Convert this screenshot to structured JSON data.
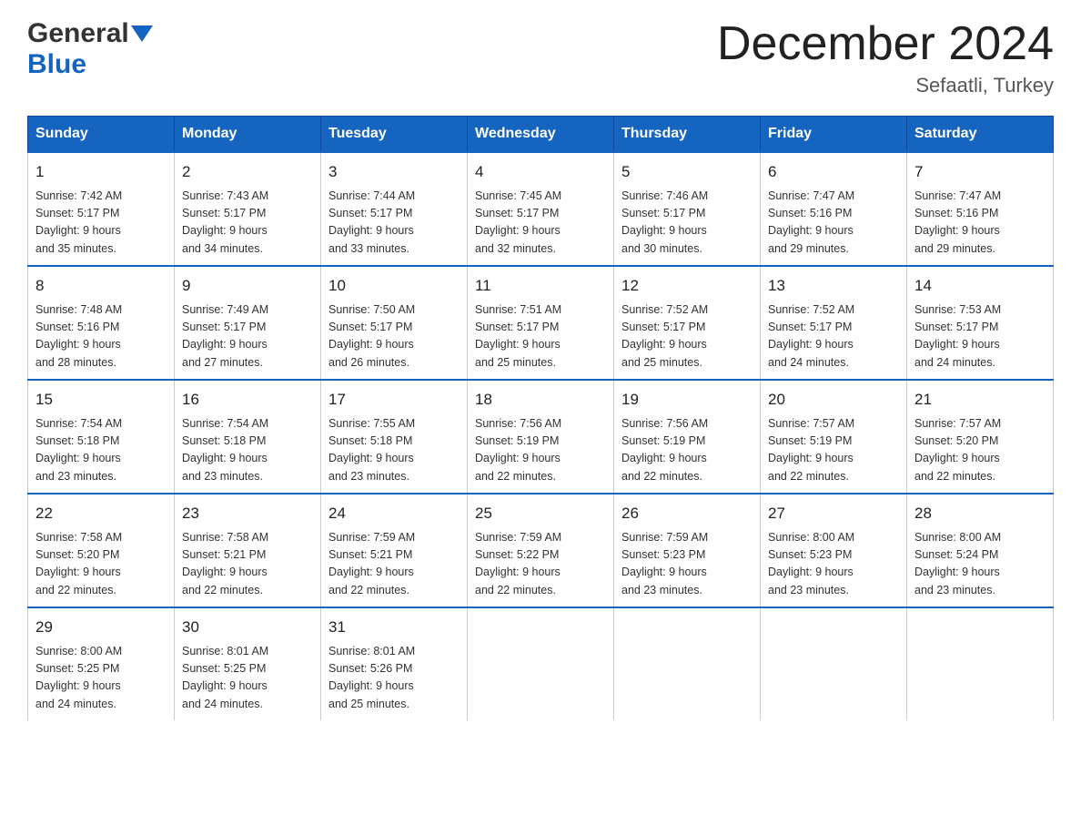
{
  "header": {
    "logo_general": "General",
    "logo_arrow": "▼",
    "logo_blue": "Blue",
    "month_title": "December 2024",
    "location": "Sefaatli, Turkey"
  },
  "days_of_week": [
    "Sunday",
    "Monday",
    "Tuesday",
    "Wednesday",
    "Thursday",
    "Friday",
    "Saturday"
  ],
  "weeks": [
    [
      {
        "day": "1",
        "sunrise": "7:42 AM",
        "sunset": "5:17 PM",
        "daylight": "9 hours and 35 minutes."
      },
      {
        "day": "2",
        "sunrise": "7:43 AM",
        "sunset": "5:17 PM",
        "daylight": "9 hours and 34 minutes."
      },
      {
        "day": "3",
        "sunrise": "7:44 AM",
        "sunset": "5:17 PM",
        "daylight": "9 hours and 33 minutes."
      },
      {
        "day": "4",
        "sunrise": "7:45 AM",
        "sunset": "5:17 PM",
        "daylight": "9 hours and 32 minutes."
      },
      {
        "day": "5",
        "sunrise": "7:46 AM",
        "sunset": "5:17 PM",
        "daylight": "9 hours and 30 minutes."
      },
      {
        "day": "6",
        "sunrise": "7:47 AM",
        "sunset": "5:16 PM",
        "daylight": "9 hours and 29 minutes."
      },
      {
        "day": "7",
        "sunrise": "7:47 AM",
        "sunset": "5:16 PM",
        "daylight": "9 hours and 29 minutes."
      }
    ],
    [
      {
        "day": "8",
        "sunrise": "7:48 AM",
        "sunset": "5:16 PM",
        "daylight": "9 hours and 28 minutes."
      },
      {
        "day": "9",
        "sunrise": "7:49 AM",
        "sunset": "5:17 PM",
        "daylight": "9 hours and 27 minutes."
      },
      {
        "day": "10",
        "sunrise": "7:50 AM",
        "sunset": "5:17 PM",
        "daylight": "9 hours and 26 minutes."
      },
      {
        "day": "11",
        "sunrise": "7:51 AM",
        "sunset": "5:17 PM",
        "daylight": "9 hours and 25 minutes."
      },
      {
        "day": "12",
        "sunrise": "7:52 AM",
        "sunset": "5:17 PM",
        "daylight": "9 hours and 25 minutes."
      },
      {
        "day": "13",
        "sunrise": "7:52 AM",
        "sunset": "5:17 PM",
        "daylight": "9 hours and 24 minutes."
      },
      {
        "day": "14",
        "sunrise": "7:53 AM",
        "sunset": "5:17 PM",
        "daylight": "9 hours and 24 minutes."
      }
    ],
    [
      {
        "day": "15",
        "sunrise": "7:54 AM",
        "sunset": "5:18 PM",
        "daylight": "9 hours and 23 minutes."
      },
      {
        "day": "16",
        "sunrise": "7:54 AM",
        "sunset": "5:18 PM",
        "daylight": "9 hours and 23 minutes."
      },
      {
        "day": "17",
        "sunrise": "7:55 AM",
        "sunset": "5:18 PM",
        "daylight": "9 hours and 23 minutes."
      },
      {
        "day": "18",
        "sunrise": "7:56 AM",
        "sunset": "5:19 PM",
        "daylight": "9 hours and 22 minutes."
      },
      {
        "day": "19",
        "sunrise": "7:56 AM",
        "sunset": "5:19 PM",
        "daylight": "9 hours and 22 minutes."
      },
      {
        "day": "20",
        "sunrise": "7:57 AM",
        "sunset": "5:19 PM",
        "daylight": "9 hours and 22 minutes."
      },
      {
        "day": "21",
        "sunrise": "7:57 AM",
        "sunset": "5:20 PM",
        "daylight": "9 hours and 22 minutes."
      }
    ],
    [
      {
        "day": "22",
        "sunrise": "7:58 AM",
        "sunset": "5:20 PM",
        "daylight": "9 hours and 22 minutes."
      },
      {
        "day": "23",
        "sunrise": "7:58 AM",
        "sunset": "5:21 PM",
        "daylight": "9 hours and 22 minutes."
      },
      {
        "day": "24",
        "sunrise": "7:59 AM",
        "sunset": "5:21 PM",
        "daylight": "9 hours and 22 minutes."
      },
      {
        "day": "25",
        "sunrise": "7:59 AM",
        "sunset": "5:22 PM",
        "daylight": "9 hours and 22 minutes."
      },
      {
        "day": "26",
        "sunrise": "7:59 AM",
        "sunset": "5:23 PM",
        "daylight": "9 hours and 23 minutes."
      },
      {
        "day": "27",
        "sunrise": "8:00 AM",
        "sunset": "5:23 PM",
        "daylight": "9 hours and 23 minutes."
      },
      {
        "day": "28",
        "sunrise": "8:00 AM",
        "sunset": "5:24 PM",
        "daylight": "9 hours and 23 minutes."
      }
    ],
    [
      {
        "day": "29",
        "sunrise": "8:00 AM",
        "sunset": "5:25 PM",
        "daylight": "9 hours and 24 minutes."
      },
      {
        "day": "30",
        "sunrise": "8:01 AM",
        "sunset": "5:25 PM",
        "daylight": "9 hours and 24 minutes."
      },
      {
        "day": "31",
        "sunrise": "8:01 AM",
        "sunset": "5:26 PM",
        "daylight": "9 hours and 25 minutes."
      },
      null,
      null,
      null,
      null
    ]
  ],
  "labels": {
    "sunrise": "Sunrise:",
    "sunset": "Sunset:",
    "daylight": "Daylight:"
  }
}
